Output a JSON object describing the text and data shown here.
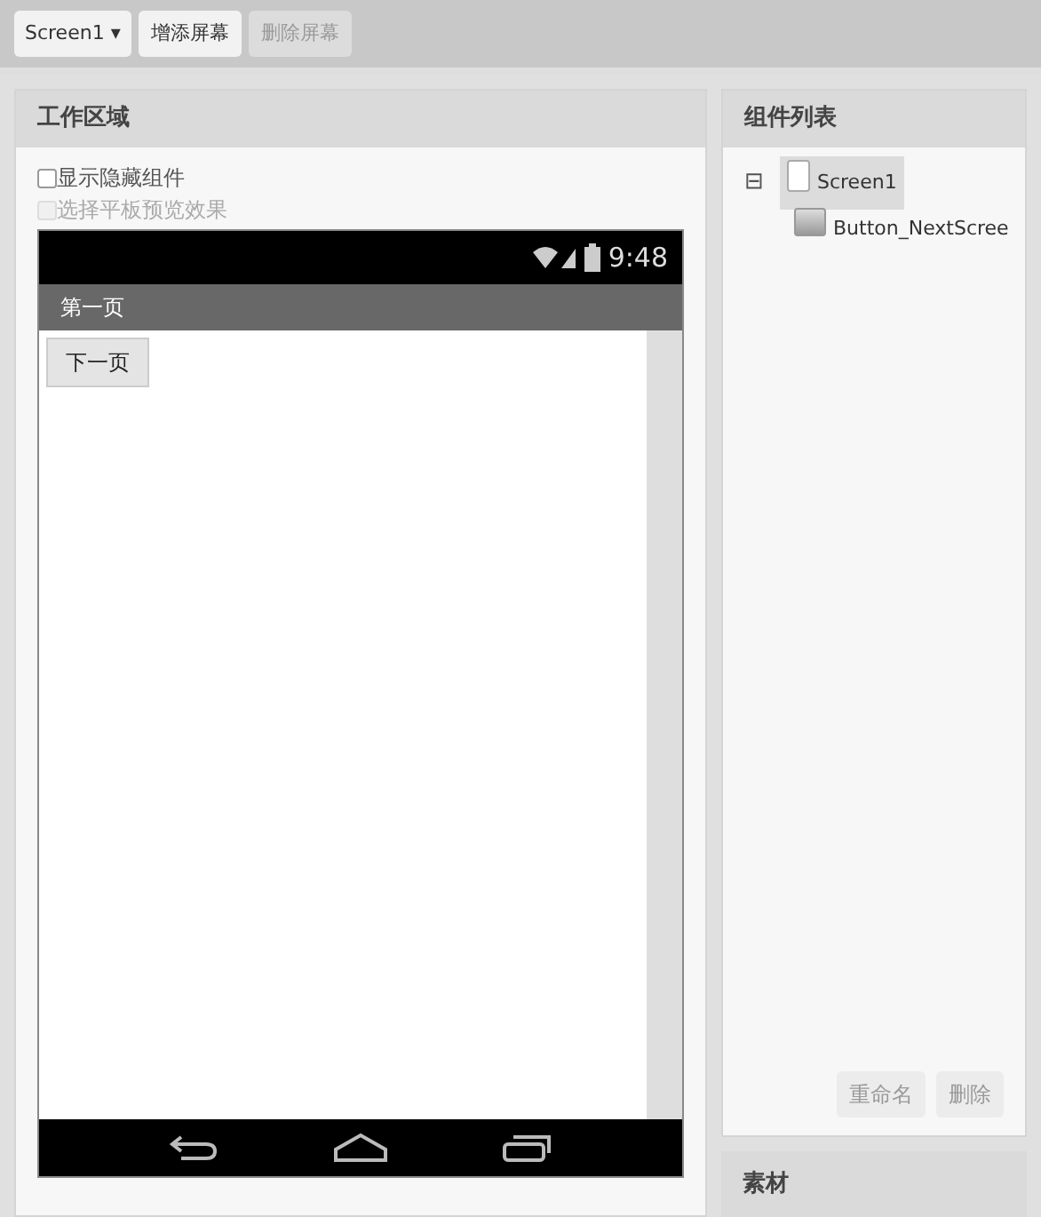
{
  "toolbar": {
    "screen_dropdown": "Screen1 ▾",
    "buttons": [
      {
        "label": "增添屏幕",
        "disabled": false
      },
      {
        "label": "删除屏幕",
        "disabled": true
      }
    ]
  },
  "workspace": {
    "title": "工作区域",
    "options": [
      {
        "label": "显示隐藏组件",
        "checked": false,
        "disabled": false
      },
      {
        "label": "选择平板预览效果",
        "checked": false,
        "disabled": true
      }
    ],
    "phone": {
      "time": "9:48",
      "title_bar": "第一页",
      "button": "下一页"
    }
  },
  "components": {
    "title": "组件列表",
    "tree": [
      {
        "label": "Screen1",
        "expanded": true,
        "selected": true,
        "collapse_glyph": "⊟",
        "children": [
          {
            "label": "Button_NextScree",
            "selected": false
          }
        ]
      }
    ],
    "buttons": [
      "重命名",
      "删除"
    ]
  },
  "media": {
    "title": "素材"
  }
}
